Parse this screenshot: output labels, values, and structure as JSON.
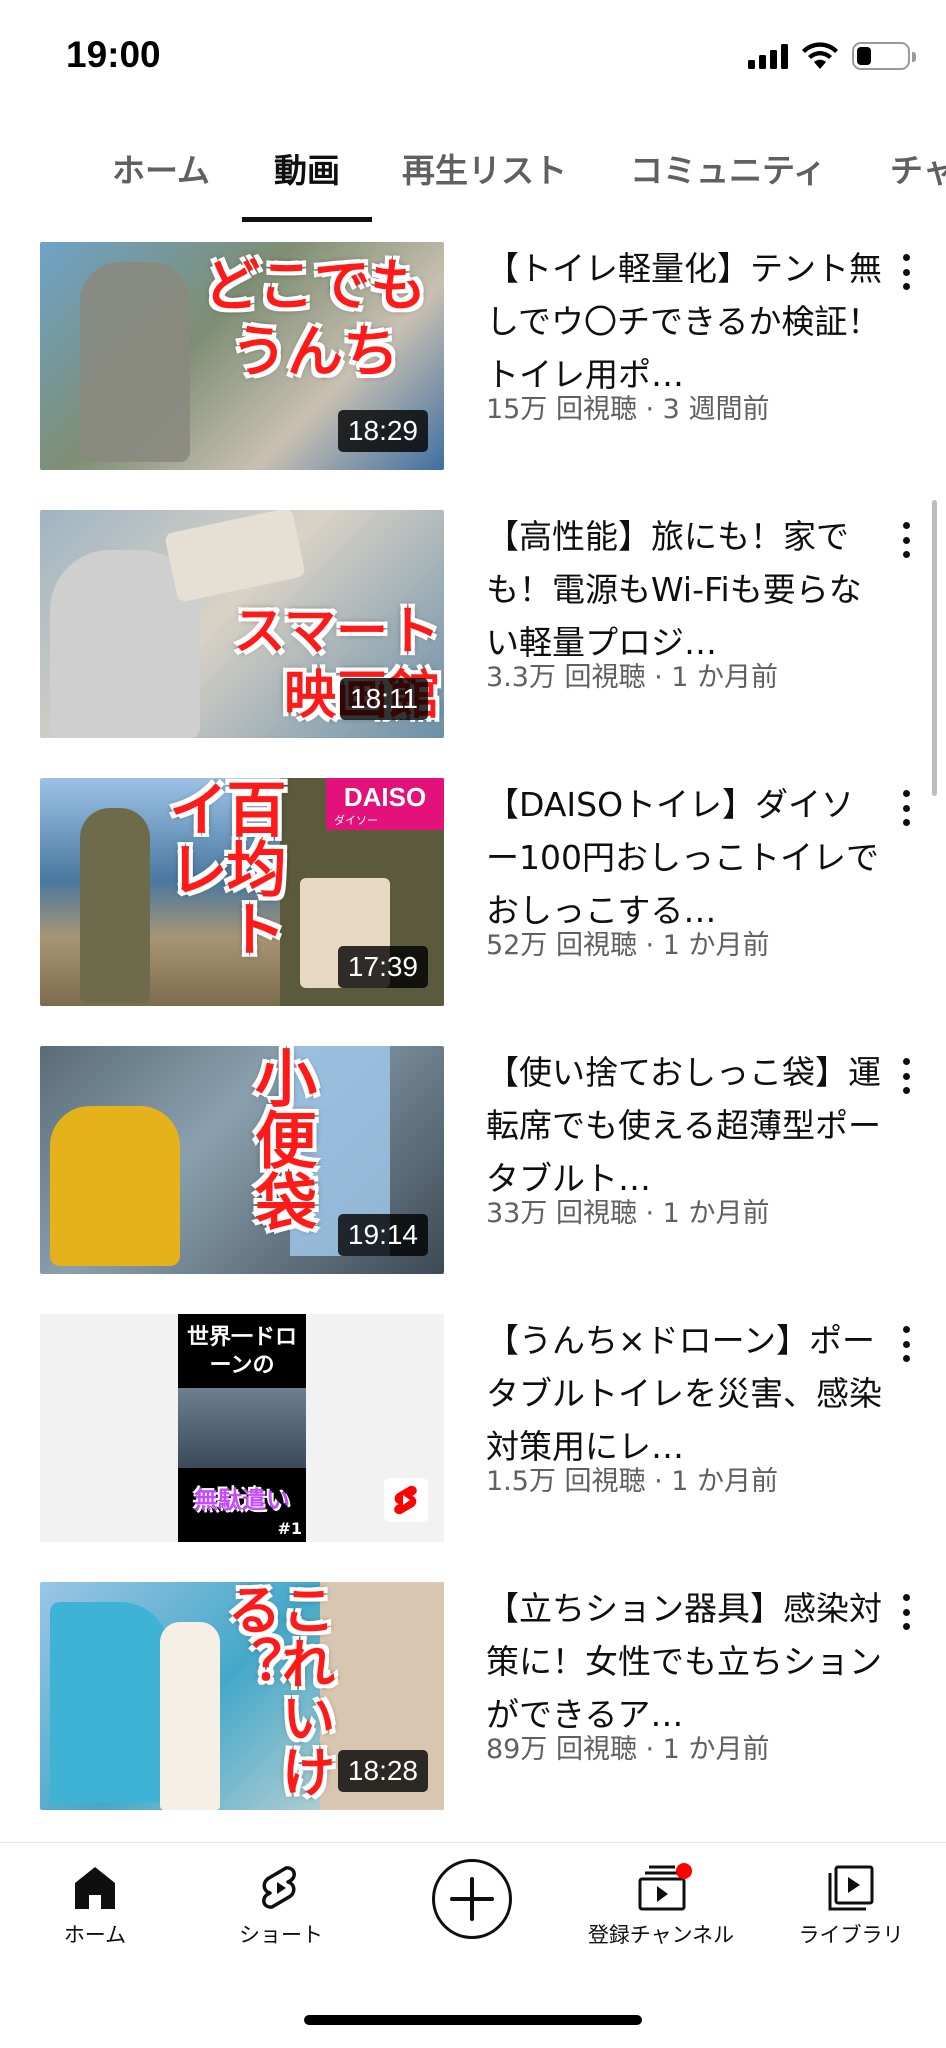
{
  "status": {
    "time": "19:00",
    "battery_level": 0.3
  },
  "tabs": [
    {
      "label": "ホーム",
      "active": false
    },
    {
      "label": "動画",
      "active": true
    },
    {
      "label": "再生リスト",
      "active": false
    },
    {
      "label": "コミュニティ",
      "active": false
    },
    {
      "label": "チャ",
      "active": false
    }
  ],
  "videos": [
    {
      "title": "【トイレ軽量化】テント無しでウ〇チできるか検証！トイレ用ポ…",
      "stats": "15万 回視聴 · 3 週間前",
      "duration": "18:29",
      "thumb_text": "どこでもうんち"
    },
    {
      "title": "【高性能】旅にも！家でも！電源もWi-Fiも要らない軽量プロジ…",
      "stats": "3.3万 回視聴 · 1 か月前",
      "duration": "18:11",
      "thumb_text": "スマート映画館"
    },
    {
      "title": "【DAISOトイレ】ダイソー100円おしっこトイレでおしっこする…",
      "stats": "52万 回視聴 · 1 か月前",
      "duration": "17:39",
      "thumb_text": "百均トイレ",
      "brand_text": "DAISO",
      "brand_sub": "ダイソー"
    },
    {
      "title": "【使い捨ておしっこ袋】運転席でも使える超薄型ポータブルト…",
      "stats": "33万 回視聴 · 1 か月前",
      "duration": "19:14",
      "thumb_text": "小便袋"
    },
    {
      "title": "【うんち×ドローン】ポータブルトイレを災害、感染対策用にレ…",
      "stats": "1.5万 回視聴 · 1 か月前",
      "duration": "",
      "thumb_text_top": "世界一ドローンの",
      "thumb_text_bottom": "無駄遣い",
      "thumb_tag": "#1"
    },
    {
      "title": "【立ちション器具】感染対策に！女性でも立ちションができるア…",
      "stats": "89万 回視聴 · 1 か月前",
      "duration": "18:28",
      "thumb_text": "これいける？"
    }
  ],
  "nav": [
    {
      "label": "ホーム",
      "icon": "home-icon"
    },
    {
      "label": "ショート",
      "icon": "shorts-icon"
    },
    {
      "label": "",
      "icon": "create-icon"
    },
    {
      "label": "登録チャンネル",
      "icon": "subscriptions-icon"
    },
    {
      "label": "ライブラリ",
      "icon": "library-icon"
    }
  ],
  "colors": {
    "accent": "#ff0000",
    "text": "#0f0f0f",
    "secondary": "#606060"
  }
}
